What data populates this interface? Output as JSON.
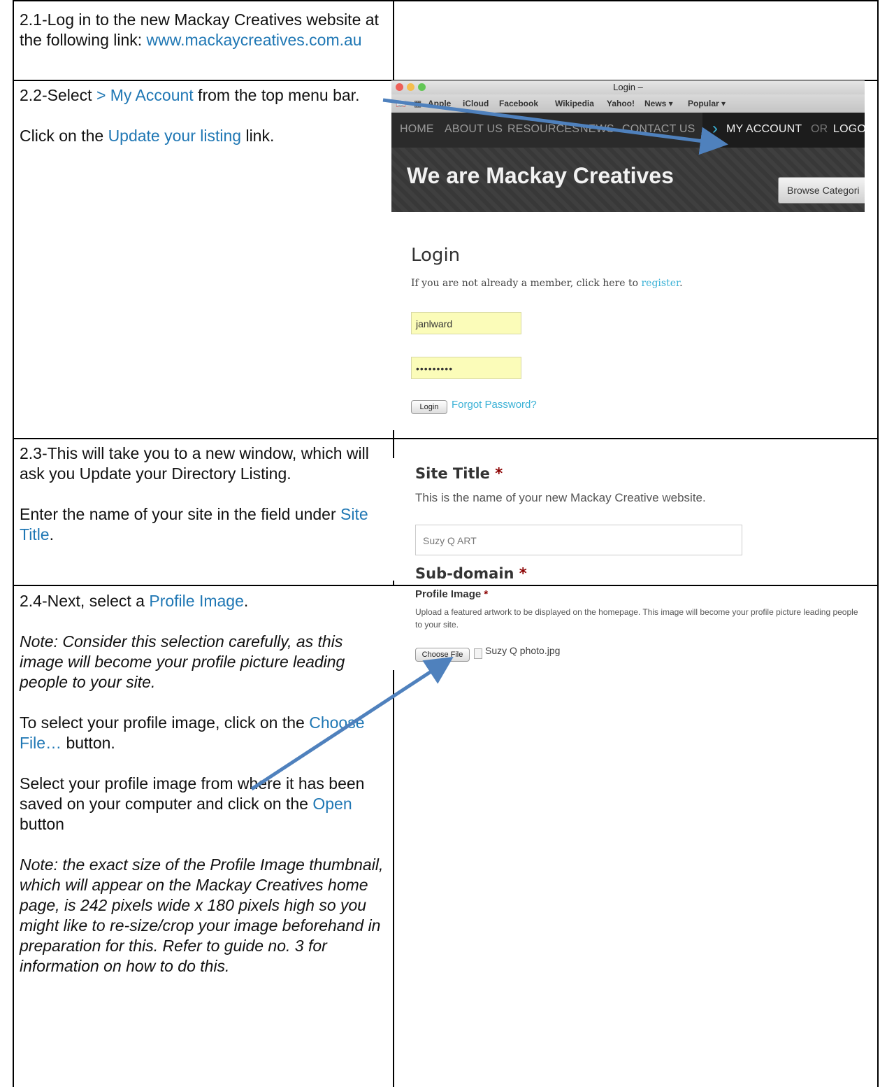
{
  "steps": {
    "s21": {
      "text": "2.1-Log in to the new Mackay Creatives website at the following link:",
      "link": "www.mackaycreatives.com.au"
    },
    "s22": {
      "prefix": "2.2-Select ",
      "link": "> My Account",
      "suffix": " from the top menu bar.",
      "line2_prefix": "Click on the ",
      "line2_link": "Update your listing",
      "line2_suffix": " link."
    },
    "s23": {
      "text": "2.3-This will take you to a new window, which will ask you Update your Directory Listing.",
      "line2_prefix": "Enter the name of your site in the field under ",
      "line2_link": "Site Title",
      "line2_suffix": "."
    },
    "s24": {
      "prefix": "2.4-Next, select a ",
      "link": "Profile Image",
      "suffix": ".",
      "note1": "Note: Consider this selection carefully, as this image will become your profile picture leading people to your site.",
      "line3_prefix": "To select your profile image, click on the ",
      "line3_link": "Choose File…",
      "line3_suffix": " button.",
      "line4_prefix": "Select your profile image from where it has been saved on your computer and click on the ",
      "line4_link": "Open",
      "line4_suffix": " button",
      "note2": "Note: the exact size of the Profile Image thumbnail, which will appear on the Mackay Creatives home page, is 242 pixels wide x 180 pixels high so you might like to re-size/crop your image beforehand in preparation for this. Refer to guide no. 3 for information on how to do this."
    }
  },
  "login_shot": {
    "window_title": "Login –",
    "bookmarks": [
      "Apple",
      "iCloud",
      "Facebook",
      "Wikipedia",
      "Yahoo!",
      "News ▾",
      "Popular ▾"
    ],
    "nav": [
      "HOME",
      "ABOUT US",
      "RESOURCES",
      "NEWS",
      "CONTACT US"
    ],
    "account": "MY ACCOUNT",
    "or": "OR",
    "logout": "LOGO",
    "banner_title": "We are Mackay Creatives",
    "browse": "Browse Categori",
    "heading": "Login",
    "intro_prefix": "If you are not already a member, click here to ",
    "intro_link": "register",
    "intro_suffix": ".",
    "username": "janlward",
    "password": "•••••••••",
    "login_button": "Login",
    "forgot": "Forgot Password?"
  },
  "site_title_shot": {
    "label": "Site Title",
    "required": "*",
    "help": "This is the name of your new Mackay Creative website.",
    "value": "Suzy Q ART",
    "sub_label": "Sub-domain"
  },
  "profile_shot": {
    "label": "Profile Image",
    "required": "*",
    "help": "Upload a featured artwork to be displayed on the homepage. This image will become your profile picture leading people to your site.",
    "button": "Choose File",
    "filename": "Suzy Q photo.jpg"
  },
  "colors": {
    "link": "#1f77b4",
    "arrow": "#4f81bd"
  }
}
